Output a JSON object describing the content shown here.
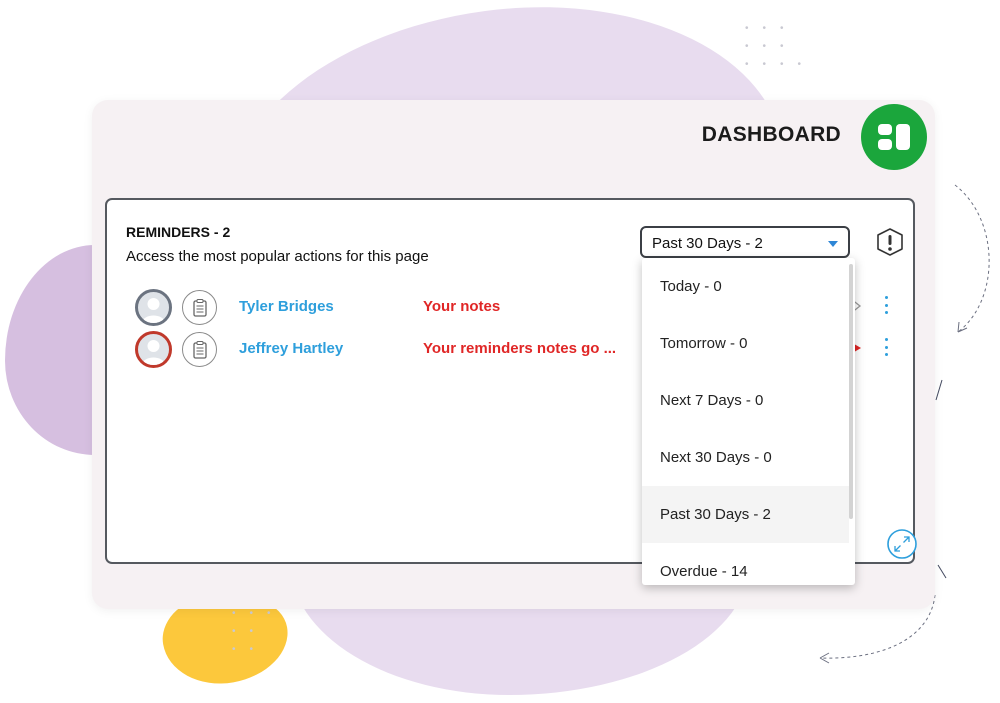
{
  "dashboard": {
    "title": "DASHBOARD",
    "logo_color": "#1ba63c"
  },
  "reminders": {
    "title": "REMINDERS - 2",
    "subtitle": "Access the most popular actions for this page",
    "rows": [
      {
        "name": "Tyler Bridges",
        "note": "Your notes",
        "avatar_border": "#6b7380"
      },
      {
        "name": "Jeffrey Hartley",
        "note": "Your reminders notes go ...",
        "avatar_border": "#c0392b"
      }
    ]
  },
  "filter": {
    "selected": "Past 30 Days - 2",
    "options": [
      "Today - 0",
      "Tomorrow - 0",
      "Next 7 Days - 0",
      "Next 30 Days - 0",
      "Past 30 Days - 2",
      "Overdue - 14"
    ]
  },
  "colors": {
    "accent": "#2e9fdc",
    "alert_text": "#e02626",
    "brand_green": "#1ba63c"
  },
  "icons": {
    "logo": "dashboard-logo-icon",
    "alert": "exclamation-circle-icon",
    "expand": "expand-arrows-icon",
    "note": "notepad-icon",
    "more": "kebab-menu-icon"
  }
}
